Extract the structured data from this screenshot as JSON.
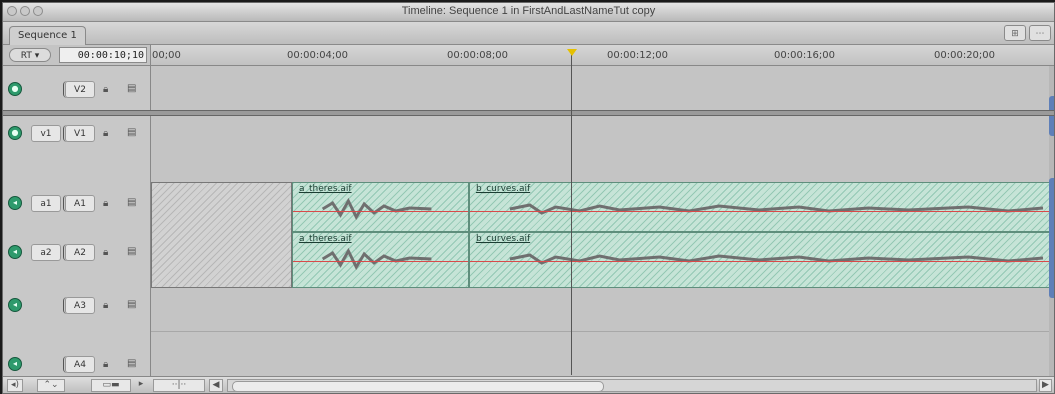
{
  "window": {
    "title": "Timeline: Sequence 1 in FirstAndLastNameTut copy"
  },
  "tabs": [
    {
      "label": "Sequence 1"
    }
  ],
  "controls": {
    "rt_label": "RT",
    "timecode": "00:00:10;10"
  },
  "ruler": {
    "labels": [
      "00;00",
      "00:00:04;00",
      "00:00:08;00",
      "00:00:12;00",
      "00:00:16;00",
      "00:00:20;00"
    ]
  },
  "video_tracks": [
    {
      "dest": "V2",
      "source": ""
    },
    {
      "dest": "V1",
      "source": "v1"
    }
  ],
  "audio_tracks": [
    {
      "dest": "A1",
      "source": "a1"
    },
    {
      "dest": "A2",
      "source": "a2"
    },
    {
      "dest": "A3",
      "source": ""
    },
    {
      "dest": "A4",
      "source": ""
    }
  ],
  "clips": {
    "a1_first": "a_theres.aif",
    "a1_second": "b_curves.aif",
    "a2_first": "a_theres.aif",
    "a2_second": "b_curves.aif"
  },
  "icons": {
    "track_visibility": "speaker-icon",
    "lock": "lock-icon",
    "auto_select": "auto-select-icon"
  },
  "colors": {
    "clip_fill": "#c6e4d7",
    "playhead": "#e5c000",
    "level_line": "#d94a4a",
    "track_toggle": "#2e9a6c"
  }
}
